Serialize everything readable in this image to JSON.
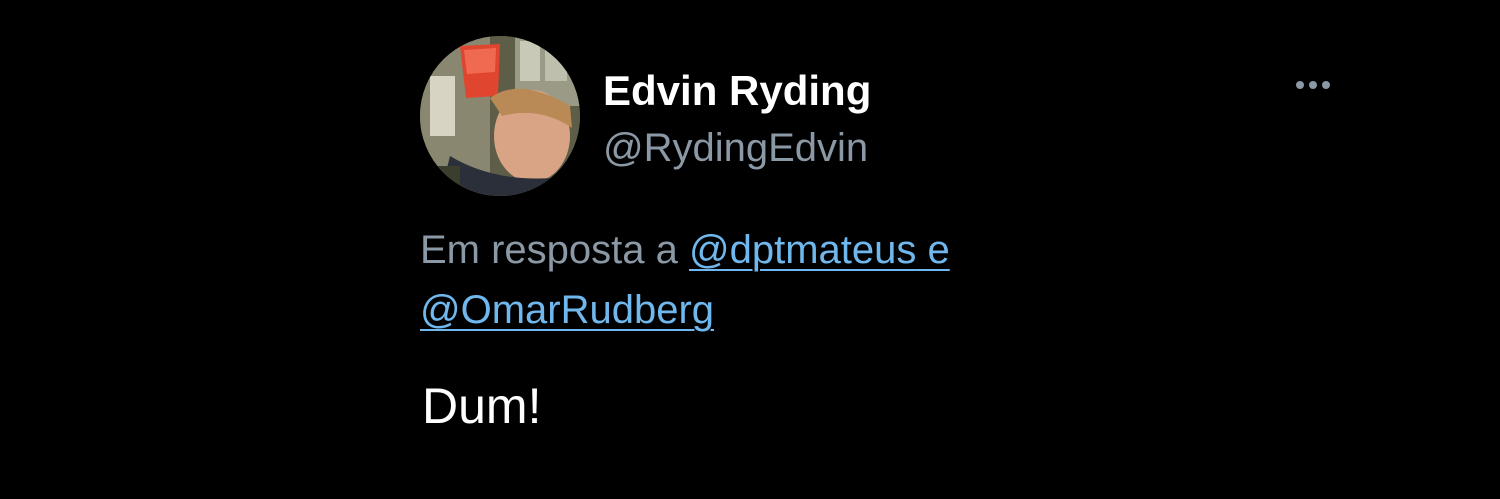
{
  "tweet": {
    "author": {
      "display_name": "Edvin Ryding",
      "handle": "@RydingEdvin"
    },
    "more_icon": "more-horizontal-icon",
    "reply_context": {
      "prefix": "Em resposta a",
      "mention_1": "@dptmateus",
      "conjunction": "e",
      "mention_2": "@OmarRudberg"
    },
    "text": "Dum!"
  },
  "colors": {
    "background": "#000000",
    "primary_text": "#ffffff",
    "secondary_text": "#8b98a5",
    "link": "#6fb7ec"
  }
}
